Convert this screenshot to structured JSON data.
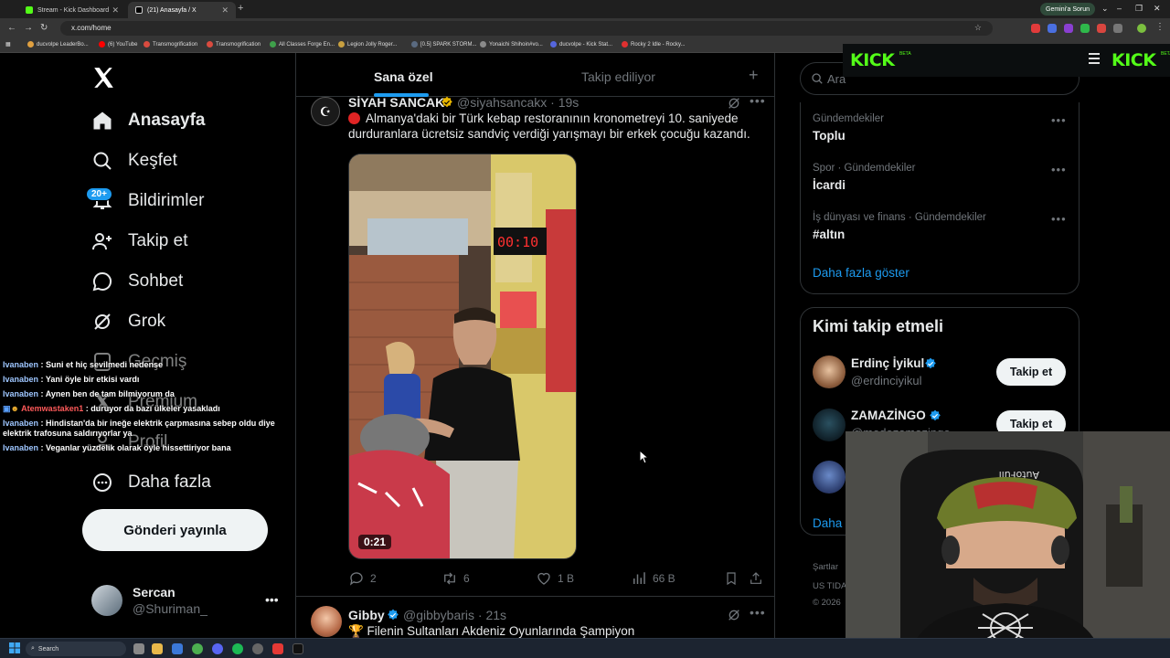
{
  "browser": {
    "tabs": [
      {
        "title": "Stream - Kick Dashboard"
      },
      {
        "title": "(21) Anasayfa / X"
      }
    ],
    "new_tab": "+",
    "profile_pill": "Gemini'a Sorun",
    "url": "x.com/home",
    "bookmarks": [
      "ducvolpe LeaderBo...",
      "(6) YouTube",
      "Transmogrification",
      "Transmogrification",
      "All Classes Forge En...",
      "Legion Jolly Roger...",
      "[0.5] SPARK STORM...",
      "Yonaichi Shihoin#vo...",
      "ducvolpe - Kick Stat...",
      "Rocky 2 Idle - Rocky..."
    ]
  },
  "nav": {
    "home": "Anasayfa",
    "explore": "Keşfet",
    "notifications": "Bildirimler",
    "notif_badge": "20+",
    "follow": "Takip et",
    "chat": "Sohbet",
    "grok": "Grok",
    "history": "Geçmiş",
    "premium": "Premium",
    "profile": "Profil",
    "more": "Daha fazla",
    "post_button": "Gönderi yayınla",
    "account_name": "Sercan",
    "account_handle": "@Shuriman_"
  },
  "chat_overlay": [
    {
      "user": "Ivanaben",
      "text": ": Suni et hiç sevilmedi nedense"
    },
    {
      "user": "Ivanaben",
      "text": ": Yani öyle bir etkisi vardı"
    },
    {
      "user": "Ivanaben",
      "text": ": Aynen ben de tam bilmiyorum da"
    },
    {
      "user": "Atemwastaken1",
      "text": ": duruyor da bazı ülkeler yasakladı"
    },
    {
      "user": "Ivanaben",
      "text": ": Hindistan'da bir ineğe elektrik çarpmasına sebep oldu diye elektrik trafosuna saldırıyorlar ya"
    },
    {
      "user": "Ivanaben",
      "text": ": Veganlar yüzdelik olarak öyle hissettiriyor bana"
    }
  ],
  "feed": {
    "tab_for_you": "Sana özel",
    "tab_following": "Takip ediliyor",
    "post1": {
      "name": "SİYAH SANCAK",
      "handle": "@siyahsancakx · 19s",
      "text": "Almanya'daki bir Türk kebap restoranının kronometreyi 10. saniyede durduranlara ücretsiz sandviç verdiği yarışmayı bir erkek çocuğu kazandı.",
      "video_time": "0:21",
      "video_timer_display": "00:10",
      "replies": "2",
      "reposts": "6",
      "likes": "1 B",
      "views": "66 B"
    },
    "post2": {
      "name": "Gibby",
      "handle": "@gibbybaris · 21s",
      "text": "🏆 Filenin Sultanları Akdeniz Oyunlarında Şampiyon"
    }
  },
  "right": {
    "search_placeholder": "Ara",
    "trends": [
      {
        "category": "Gündemdekiler",
        "name": "Toplu"
      },
      {
        "category": "Spor · Gündemdekiler",
        "name": "İcardi"
      },
      {
        "category": "İş dünyası ve finans · Gündemdekiler",
        "name": "#altın"
      }
    ],
    "show_more": "Daha fazla göster",
    "who_to_follow_title": "Kimi takip etmeli",
    "who_to_follow": [
      {
        "name": "Erdinç İyikul",
        "handle": "@erdinciyikul",
        "button": "Takip et"
      },
      {
        "name": "ZAMAZİNGO",
        "handle": "@modozamazingo",
        "button": "Takip et"
      }
    ],
    "show_more_partial": "Daha",
    "footer_1": "Şartlar",
    "footer_2": "US TIDA",
    "footer_3": "© 2026"
  },
  "kick": {
    "logo": "KICK",
    "beta": "BETA",
    "colors": {
      "brand": "#53fc18"
    }
  },
  "webcam": {
    "cap_text": "AutoFull"
  },
  "taskbar": {
    "search": "Search"
  },
  "colors": {
    "accent": "#1d9bf0",
    "background": "#000000",
    "muted": "#71767b",
    "kick_green": "#53fc18"
  }
}
